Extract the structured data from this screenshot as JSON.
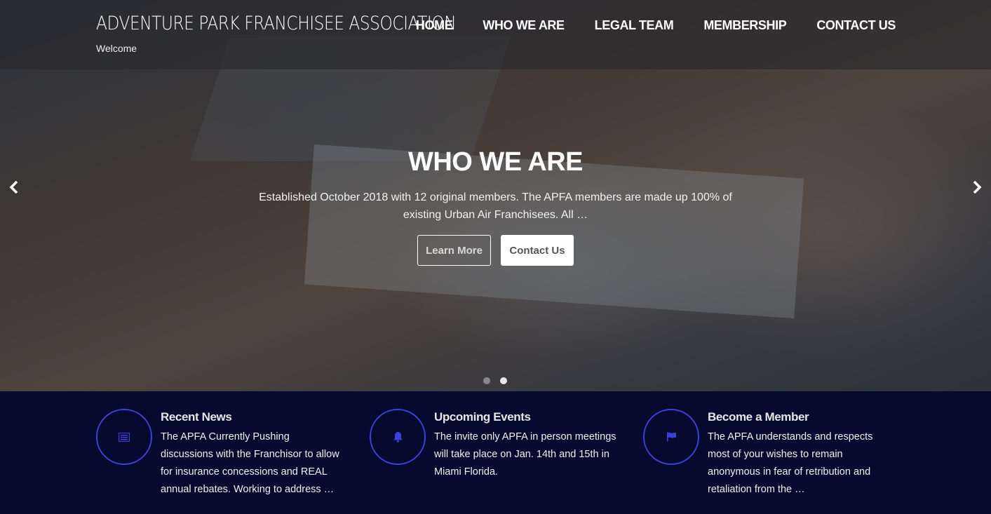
{
  "header": {
    "brand_title": "ADVENTURE PARK FRANCHISEE ASSOCIATION",
    "brand_subtitle": "Welcome",
    "nav": [
      "HOME",
      "WHO WE ARE",
      "LEGAL TEAM",
      "MEMBERSHIP",
      "CONTACT US"
    ]
  },
  "hero": {
    "title": "WHO WE ARE",
    "text": "Established October 2018 with 12 original members. The APFA members are made up 100% of existing Urban Air Franchisees. All …",
    "learn_more": "Learn More",
    "contact_us": "Contact Us",
    "prev_icon": "chevron-left-icon",
    "next_icon": "chevron-right-icon",
    "slide_count": 2,
    "active_slide": 2
  },
  "features": [
    {
      "icon": "newspaper-icon",
      "title": "Recent News",
      "text": "The APFA Currently Pushing discussions with the Franchisor to allow for insurance concessions and REAL annual rebates. Working to address …"
    },
    {
      "icon": "bell-icon",
      "title": "Upcoming Events",
      "text": "The invite only APFA in person meetings will take place on Jan. 14th and 15th in Miami Florida."
    },
    {
      "icon": "flag-icon",
      "title": "Become a Member",
      "text": "The APFA understands and respects most of your wishes to remain anonymous in fear of retribution and retaliation from the …"
    }
  ],
  "colors": {
    "accent": "#3c3fd8",
    "footer_bg": "#060a2e"
  }
}
